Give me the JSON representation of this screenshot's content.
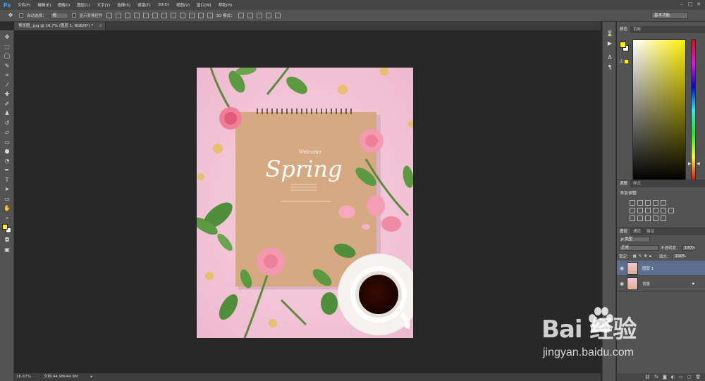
{
  "app": {
    "logo": "Ps"
  },
  "menu": [
    "文件(F)",
    "编辑(E)",
    "图像(I)",
    "图层(L)",
    "文字(Y)",
    "选择(S)",
    "滤镜(T)",
    "3D(D)",
    "视图(V)",
    "窗口(W)",
    "帮助(H)"
  ],
  "window_controls": [
    "–",
    "□",
    "✕"
  ],
  "options": {
    "auto_select_label": "自动选择：",
    "auto_select_value": "组",
    "show_transform_label": "显示变换控件",
    "mode_3d_label": "3D 模式：",
    "workspace": "基本功能"
  },
  "document": {
    "tab_title": "预览图_.jpg @ 16.7% (图层 1, RGB/8*) *",
    "tab_close": "×",
    "art": {
      "welcome": "Welcome",
      "title": "Spring"
    }
  },
  "status": {
    "zoom": "16.67%",
    "doc_size": "文档:44.9M/44.9M",
    "arrow": "▸"
  },
  "panels": {
    "color_tabs": [
      "颜色",
      "色板"
    ],
    "adjust_tabs": [
      "调整",
      "样式"
    ],
    "adjust_title": "添加调整",
    "layer_tabs": [
      "图层",
      "通道",
      "路径"
    ],
    "kind_select": "ρ 类型",
    "blend_mode": "正常",
    "opacity_label": "不透明度：",
    "opacity_value": "100%",
    "lock_label": "锁定：",
    "fill_label": "填充：",
    "fill_value": "100%",
    "layers": [
      {
        "name": "图层 1",
        "selected": true
      },
      {
        "name": "背景",
        "selected": false
      }
    ]
  },
  "watermark": {
    "brand": "Bai  经验",
    "url": "jingyan.baidu.com"
  },
  "colors": {
    "foreground": "#fff000",
    "background": "#ffffff",
    "art_bg": "#f3c8d9"
  }
}
